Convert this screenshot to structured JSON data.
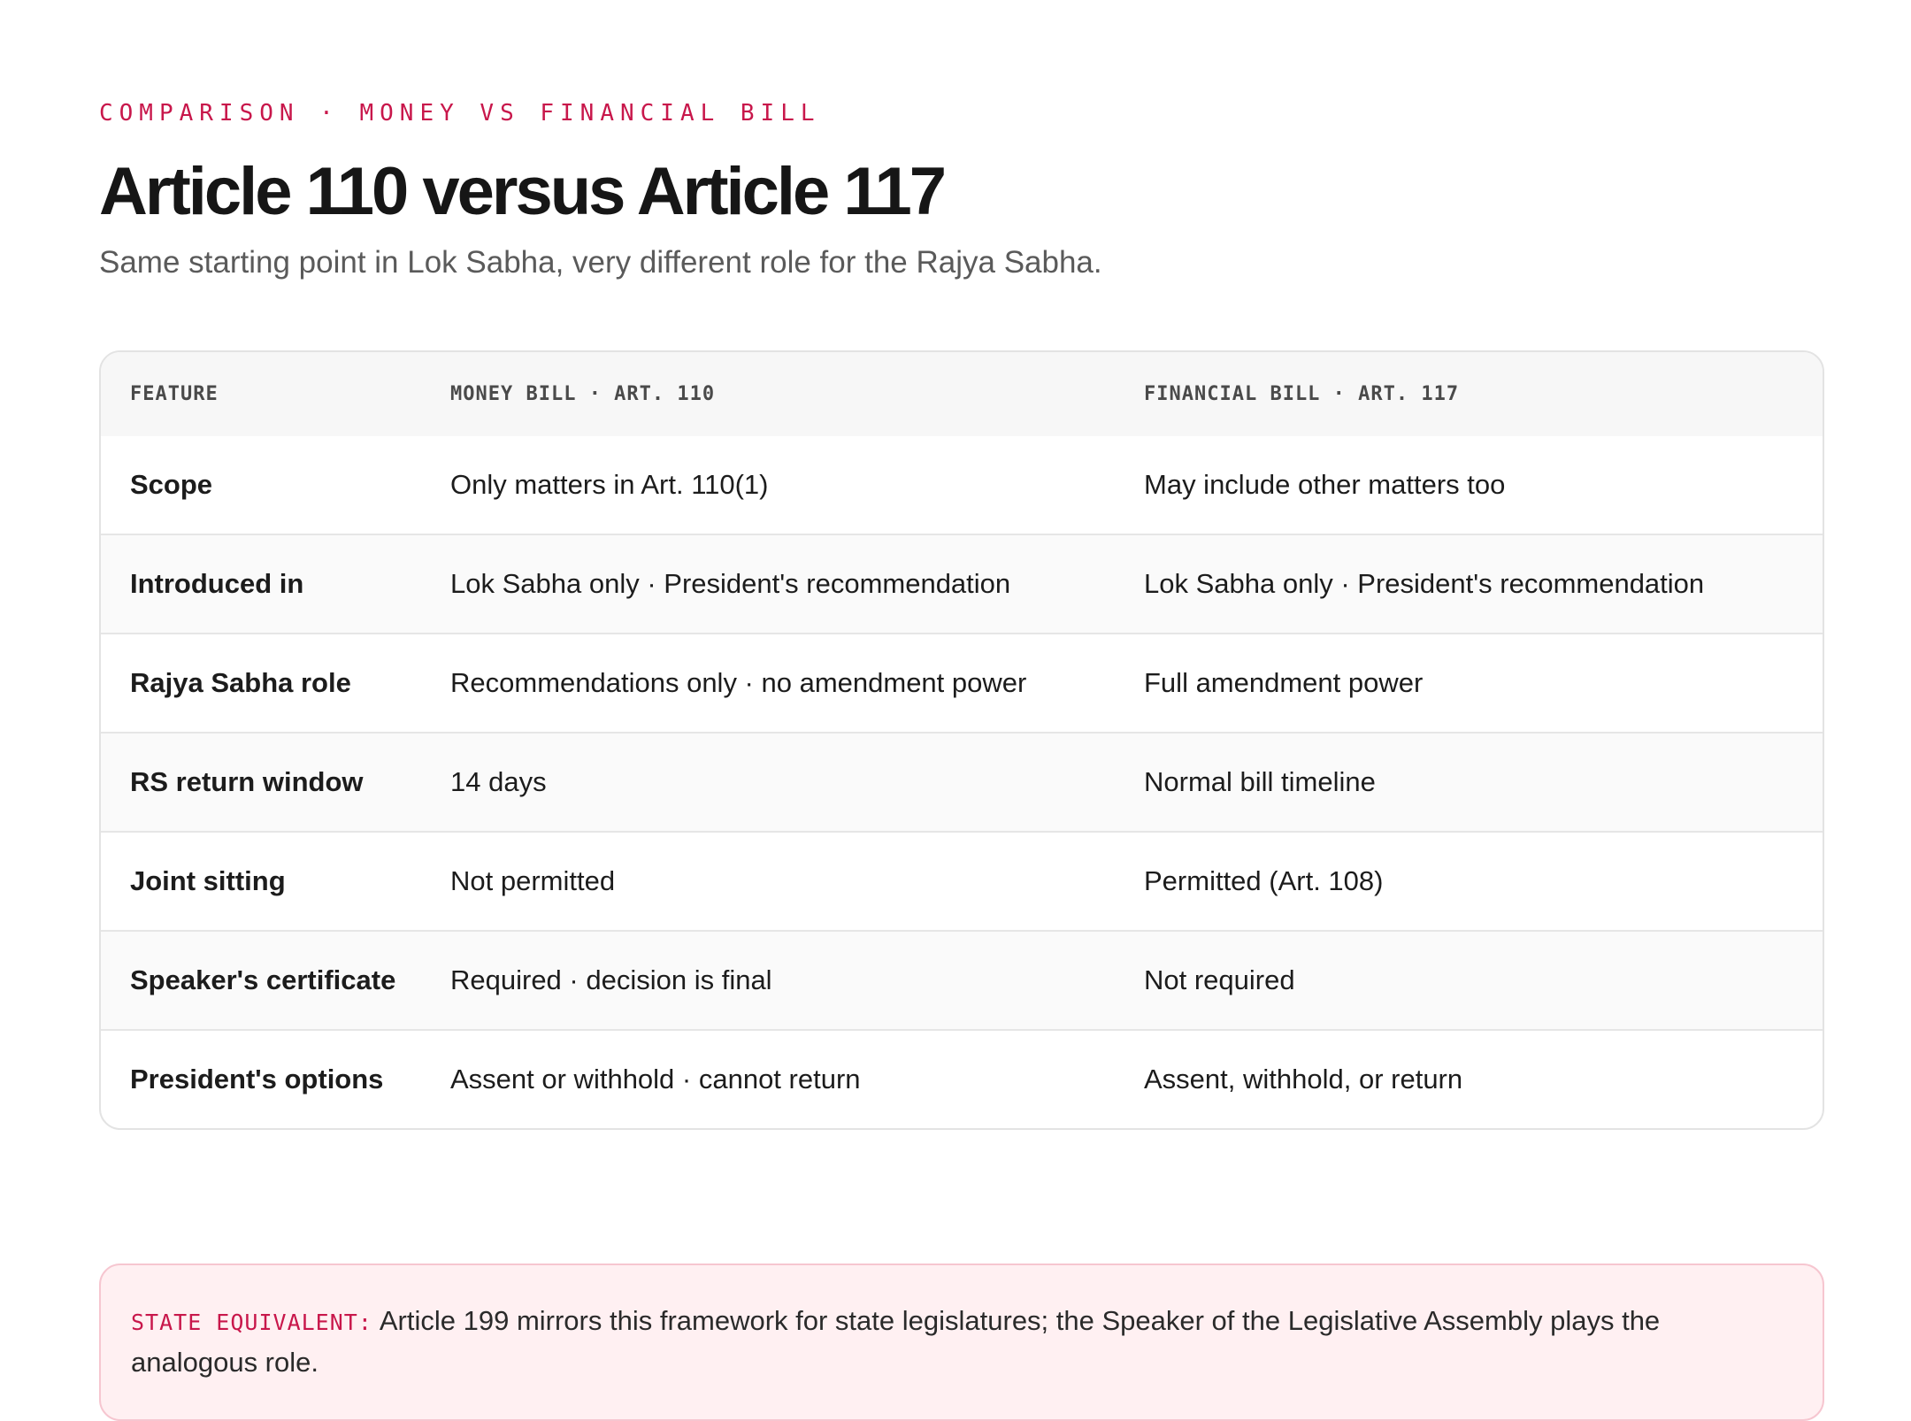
{
  "header": {
    "eyebrow": "COMPARISON · MONEY VS FINANCIAL BILL",
    "title": "Article 110 versus Article 117",
    "subtitle": "Same starting point in Lok Sabha, very different role for the Rajya Sabha."
  },
  "table": {
    "columns": [
      "FEATURE",
      "MONEY BILL · ART. 110",
      "FINANCIAL BILL · ART. 117"
    ],
    "rows": [
      [
        "Scope",
        "Only matters in Art. 110(1)",
        "May include other matters too"
      ],
      [
        "Introduced in",
        "Lok Sabha only · President's recommendation",
        "Lok Sabha only · President's recommendation"
      ],
      [
        "Rajya Sabha role",
        "Recommendations only · no amendment power",
        "Full amendment power"
      ],
      [
        "RS return window",
        "14 days",
        "Normal bill timeline"
      ],
      [
        "Joint sitting",
        "Not permitted",
        "Permitted (Art. 108)"
      ],
      [
        "Speaker's certificate",
        "Required · decision is final",
        "Not required"
      ],
      [
        "President's options",
        "Assent or withhold · cannot return",
        "Assent, withhold, or return"
      ]
    ]
  },
  "callout": {
    "label": "STATE EQUIVALENT:",
    "text": "Article 199 mirrors this framework for state legislatures; the Speaker of the Legislative Assembly plays the analogous role."
  },
  "colors": {
    "accent": "#c8174b",
    "callout_bg": "#fff0f2",
    "callout_border": "#f6c6d0"
  }
}
